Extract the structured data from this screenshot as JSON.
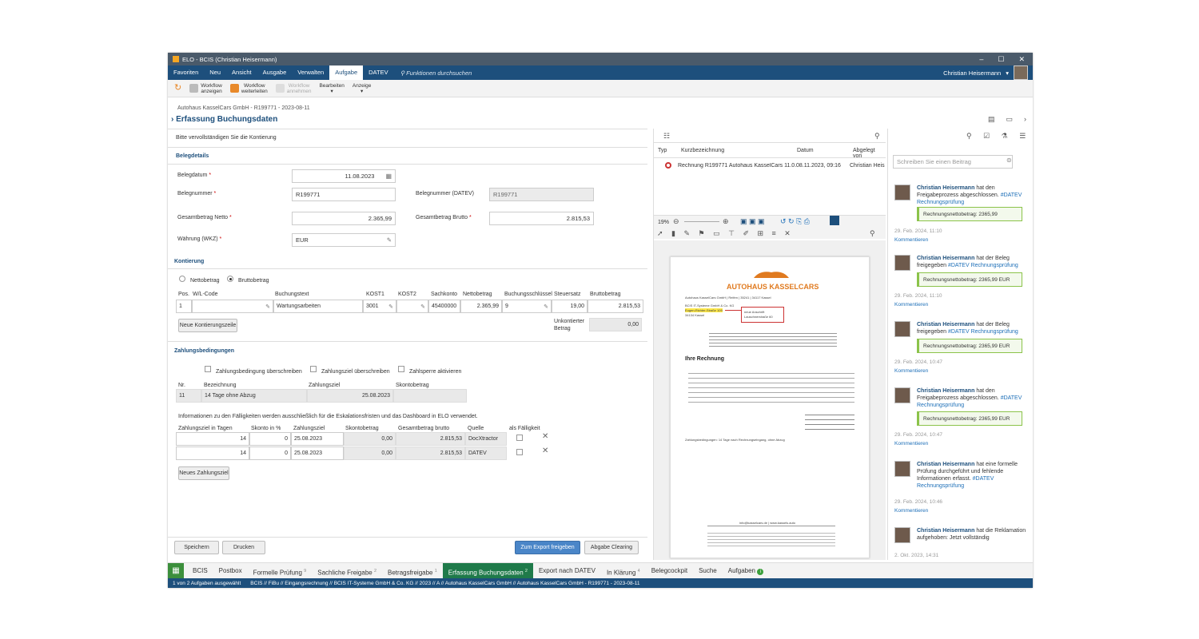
{
  "window": {
    "title": "ELO - BCIS (Christian Heisermann)"
  },
  "ribbon": {
    "tabs": [
      "Favoriten",
      "Neu",
      "Ansicht",
      "Ausgabe",
      "Verwalten",
      "Aufgabe",
      "DATEV"
    ],
    "search": "Funktionen durchsuchen",
    "user": "Christian Heisermann"
  },
  "toolbar": {
    "workflow_anzeigen": [
      "Workflow",
      "anzeigen"
    ],
    "workflow_weiterleiten": [
      "Workflow",
      "weiterleiten"
    ],
    "workflow_annehmen": [
      "Workflow",
      "annehmen"
    ],
    "bearbeiten": "Bearbeiten",
    "anzeige": "Anzeige"
  },
  "breadcrumb": "Autohaus KasselCars GmbH - R199771 - 2023-08-11",
  "page_title": "Erfassung Buchungsdaten",
  "form": {
    "instruction": "Bitte vervollständigen Sie die Kontierung",
    "belegdetails": "Belegdetails",
    "belegdatum_label": "Belegdatum",
    "belegdatum": "11.08.2023",
    "belegnummer_label": "Belegnummer",
    "belegnummer": "R199771",
    "belegnummer_datev_label": "Belegnummer (DATEV)",
    "belegnummer_datev": "R199771",
    "netto_label": "Gesamtbetrag Netto",
    "netto": "2.365,99",
    "brutto_label": "Gesamtbetrag Brutto",
    "brutto": "2.815,53",
    "waehrung_label": "Währung (WKZ)",
    "waehrung": "EUR",
    "kontierung": "Kontierung",
    "radio_netto": "Nettobetrag",
    "radio_brutto": "Bruttobetrag",
    "cols": [
      "Pos.",
      "W/L-Code",
      "Buchungstext",
      "KOST1",
      "KOST2",
      "Sachkonto",
      "Nettobetrag",
      "Buchungsschlüssel",
      "Steuersatz",
      "Bruttobetrag"
    ],
    "row": {
      "pos": "1",
      "wl": "",
      "text": "Wartungsarbeiten",
      "kost1": "3001",
      "kost2": "",
      "sachkonto": "45400000",
      "netto": "2.365,99",
      "schluessel": "9",
      "steuer": "19,00",
      "brutto": "2.815,53"
    },
    "neue_zeile": "Neue Kontierungszeile",
    "unkontiert_label": [
      "Unkontierter",
      "Betrag"
    ],
    "unkontiert": "0,00",
    "zahlungsbedingungen": "Zahlungsbedingungen",
    "cb1": "Zahlungsbedingung überschreiben",
    "cb2": "Zahlungsziel überschreiben",
    "cb3": "Zahlsperre aktivieren",
    "zb_cols": [
      "Nr.",
      "Bezeichnung",
      "Zahlungsziel",
      "Skontobetrag"
    ],
    "zb_row": {
      "nr": "11",
      "bez": "14 Tage ohne Abzug",
      "ziel": "25.08.2023",
      "skonto": ""
    },
    "info": "Informationen zu den Fälligkeiten werden ausschließlich für die Eskalationsfristen und das Dashboard in ELO verwendet.",
    "f_cols": [
      "Zahlungsziel in Tagen",
      "Skonto in %",
      "Zahlungsziel",
      "Skontobetrag",
      "Gesamtbetrag brutto",
      "Quelle",
      "als Fälligkeit"
    ],
    "f_rows": [
      {
        "tage": "14",
        "skonto": "0",
        "ziel": "25.08.2023",
        "sb": "0,00",
        "brutto": "2.815,53",
        "quelle": "DocXtractor"
      },
      {
        "tage": "14",
        "skonto": "0",
        "ziel": "25.08.2023",
        "sb": "0,00",
        "brutto": "2.815,53",
        "quelle": "DATEV"
      }
    ],
    "neues_ziel": "Neues Zahlungsziel",
    "speichern": "Speichern",
    "drucken": "Drucken",
    "export": "Zum Export freigeben",
    "clearing": "Abgabe Clearing"
  },
  "docs": {
    "cols": [
      "Typ",
      "Kurzbezeichnung",
      "Datum",
      "Abgelegt von"
    ],
    "row": {
      "name": "Rechnung R199771 Autohaus KasselCars 11.0...",
      "date": "08.11.2023, 09:16",
      "by": "Christian Heis"
    },
    "zoom": "19%"
  },
  "invoice": {
    "company": "AUTOHAUS KASSELCARS",
    "address_line": "Autohaus KasselCars GmbH | Reifen | 35241 | 34117 Kassel",
    "sender": [
      "BCIS IT-Systeme GmbH & Co. KG",
      "Eugen-Richter-Straße 109",
      "34134 Kassel"
    ],
    "note": [
      "neue Anschrift",
      "Lauschnerstraße 60"
    ],
    "heading": "Ihre Rechnung",
    "footer": "info@kasselcars.de | www.kassels.auto",
    "terms": "Zahlungsbedingungen: 14 Tage nach Rechnungseingang, ohne Abzug"
  },
  "feed": {
    "placeholder": "Schreiben Sie einen Beitrag",
    "comments": [
      {
        "name": "Christian Heisermann",
        "text": "hat den Freigabeprozess abgeschlossen.",
        "tag": "#DATEV Rechnungsprüfung",
        "box": "Rechnungsnettobetrag: 2365,99",
        "date": "29. Feb. 2024, 11:10",
        "link": "Kommentieren"
      },
      {
        "name": "Christian Heisermann",
        "text": "hat der Beleg freigegeben",
        "tag": "#DATEV Rechnungsprüfung",
        "box": "Rechnungsnettobetrag: 2365,99 EUR",
        "date": "29. Feb. 2024, 11:10",
        "link": "Kommentieren"
      },
      {
        "name": "Christian Heisermann",
        "text": "hat der Beleg freigegeben",
        "tag": "#DATEV Rechnungsprüfung",
        "box": "Rechnungsnettobetrag: 2365,99 EUR",
        "date": "29. Feb. 2024, 10:47",
        "link": "Kommentieren"
      },
      {
        "name": "Christian Heisermann",
        "text": "hat den Freigabeprozess abgeschlossen.",
        "tag": "#DATEV Rechnungsprüfung",
        "box": "Rechnungsnettobetrag: 2365,99 EUR",
        "date": "29. Feb. 2024, 10:47",
        "link": "Kommentieren"
      },
      {
        "name": "Christian Heisermann",
        "text": "hat eine formelle Prüfung durchgeführt und fehlende Informationen erfasst.",
        "tag": "#DATEV Rechnungsprüfung",
        "box": "",
        "date": "29. Feb. 2024, 10:46",
        "link": "Kommentieren"
      },
      {
        "name": "Christian Heisermann",
        "text": "hat die Reklamation aufgehoben: Jetzt vollständig",
        "tag": "",
        "box": "",
        "date": "2. Okt. 2023, 14:31",
        "link": ""
      }
    ]
  },
  "bottom_tabs": [
    {
      "label": "BCIS",
      "badge": ""
    },
    {
      "label": "Postbox",
      "badge": ""
    },
    {
      "label": "Formelle Prüfung",
      "badge": "9"
    },
    {
      "label": "Sachliche Freigabe",
      "badge": "2"
    },
    {
      "label": "Betragsfreigabe",
      "badge": "1"
    },
    {
      "label": "Erfassung Buchungsdaten",
      "badge": "2"
    },
    {
      "label": "Export nach DATEV",
      "badge": ""
    },
    {
      "label": "In Klärung",
      "badge": "4"
    },
    {
      "label": "Belegcockpit",
      "badge": ""
    },
    {
      "label": "Suche",
      "badge": ""
    },
    {
      "label": "Aufgaben",
      "badge": ""
    }
  ],
  "status": {
    "selection": "1 von 2 Aufgaben ausgewählt",
    "path": "BCIS // FiBu // Eingangsrechnung // BCIS IT-Systeme GmbH & Co. KG // 2023 // A // Autohaus KasselCars GmbH // Autohaus KasselCars GmbH - R199771 - 2023-08-11"
  }
}
